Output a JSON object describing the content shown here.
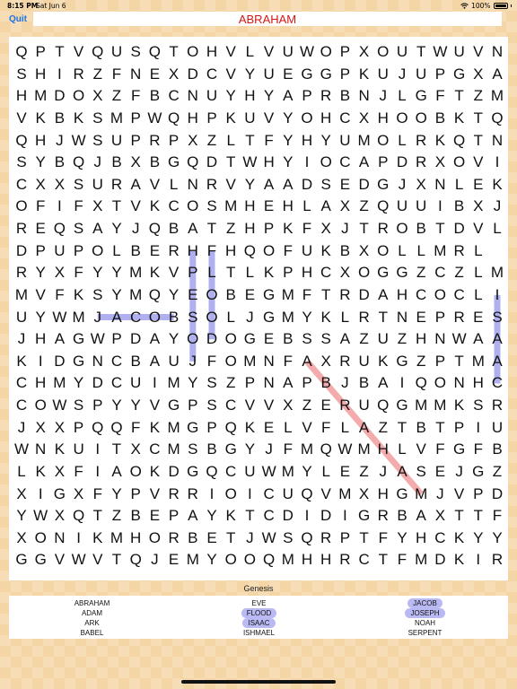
{
  "status": {
    "time": "8:15 PM",
    "date": "Sat Jun 6",
    "battery": "100%"
  },
  "toolbar": {
    "quit_label": "Quit",
    "current_word": "ABRAHAM"
  },
  "grid_rows": [
    "QPTVQUSQTOHVLVUWOPXOUTWUVN",
    "SHIRZFNEXDCVYUEGGPKUJUPGXA",
    "HMDOXZFBCNUYHYAPRBNJLGFTZM",
    "VKBKSMPWQHPKUVYOHCXHOOBKTQ",
    "QHJWSUPRPXZLTFYHYUMOLRKQTN",
    "SYBQJBXBGQDTWHYIOCAPDRXOVI",
    "CXXSURAVLNRVYAADSEDGJXNLEK",
    "OFIFXTVKCOSMHEHLAXZQUUIBXJ",
    "REQSAYJQBATZHPKFXJTROBTDVL",
    "DPUPOLBERHFHQOFUKBXOLLMRL",
    "RYXFYYMKVPLTLKPHCXOGGZCZLM",
    "MVFKSYMQYEOBEGMFTRDAHCOCLI",
    "UYWMJACOBSOLJGMYKLRTNEPRES",
    "JHAGWPDAYODOGEBSSAZUZHNWAA",
    "KIDGNCBAUJFOMNFAXRUKGZPTMA",
    "CHMYDCUIMYSZPNAPBJBAIQONHC",
    "COWSPYYVGPSCVVXZERUQGMMKSR",
    "JXXPQQFKMGPQKELVFLAZTBTPIU",
    "WNKUITXCMSBGYJFMQWMHLVFGFB",
    "LKXFIAOKDGQCUWMYLEZJASEJGZ",
    "XIGXFYPVRRIOICUQVMXHGMJVPD",
    "YWXQTZBEPAYKTCDIDIGRBAXTTF",
    "XONIKMHORBETJWSQRPTFYHCKYY",
    "GGVWVTQJEMYOOQMHHRCTFMDKIR"
  ],
  "highlights": [
    {
      "word": "JACOB",
      "color": "#a8a8ef",
      "from": [
        12,
        4
      ],
      "to": [
        12,
        8
      ]
    },
    {
      "word": "FLOOD",
      "color": "#a8a8ef",
      "from": [
        9,
        10
      ],
      "to": [
        13,
        10
      ]
    },
    {
      "word": "ISAAC",
      "color": "#a8a8ef",
      "from": [
        11,
        25
      ],
      "to": [
        15,
        25
      ]
    },
    {
      "word": "JOSEPH",
      "color": "#a8a8ef",
      "from": [
        9,
        9
      ],
      "to": [
        14,
        9
      ]
    },
    {
      "word": "ABRAHAM",
      "color": "#f3a3a3",
      "from": [
        14,
        15
      ],
      "to": [
        20,
        21
      ]
    }
  ],
  "category": "Genesis",
  "wordlist": {
    "columns": [
      [
        {
          "text": "ABRAHAM",
          "found": false
        },
        {
          "text": "ADAM",
          "found": false
        },
        {
          "text": "ARK",
          "found": false
        },
        {
          "text": "BABEL",
          "found": false
        }
      ],
      [
        {
          "text": "EVE",
          "found": false
        },
        {
          "text": "FLOOD",
          "found": true
        },
        {
          "text": "ISAAC",
          "found": true
        },
        {
          "text": "ISHMAEL",
          "found": false
        }
      ],
      [
        {
          "text": "JACOB",
          "found": true
        },
        {
          "text": "JOSEPH",
          "found": true
        },
        {
          "text": "NOAH",
          "found": false
        },
        {
          "text": "SERPENT",
          "found": false
        }
      ]
    ]
  }
}
